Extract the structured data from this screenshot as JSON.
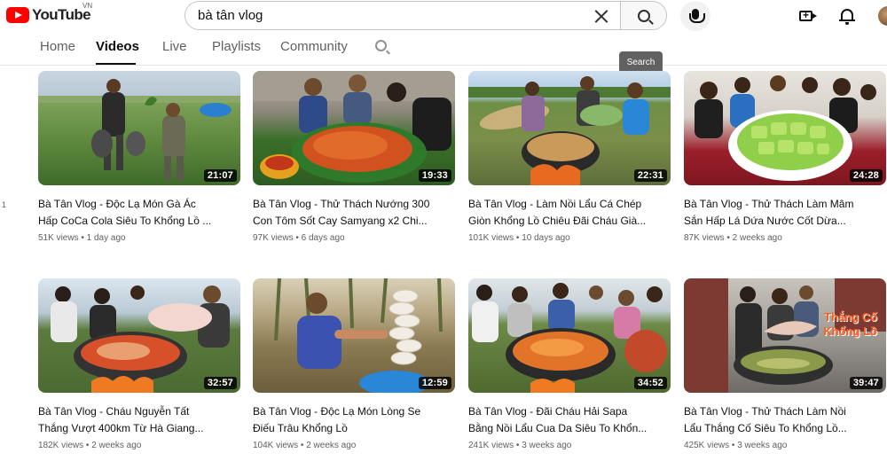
{
  "header": {
    "logo_text": "YouTube",
    "logo_country": "VN",
    "search_value": "bà tân vlog",
    "search_tooltip": "Search",
    "icons": [
      "youtube-logo-icon",
      "clear-icon",
      "search-icon",
      "microphone-icon",
      "create-video-icon",
      "notifications-bell-icon",
      "avatar"
    ]
  },
  "tabs": [
    {
      "label": "Home",
      "active": false
    },
    {
      "label": "Videos",
      "active": true
    },
    {
      "label": "Live",
      "active": false
    },
    {
      "label": "Playlists",
      "active": false
    },
    {
      "label": "Community",
      "active": false
    }
  ],
  "edge_text": "1",
  "videos": [
    {
      "title_line1": "Bà Tân Vlog - Độc Lạ Món Gà Ác",
      "title_line2": "Hấp CoCa Cola Siêu To Khổng Lồ ...",
      "views": "51K views",
      "age": "1 day ago",
      "duration": "21:07",
      "overlay": ""
    },
    {
      "title_line1": "Bà Tân Vlog - Thử Thách Nướng 300",
      "title_line2": "Con Tôm Sốt Cay Samyang x2 Chi...",
      "views": "97K views",
      "age": "6 days ago",
      "duration": "19:33",
      "overlay": ""
    },
    {
      "title_line1": "Bà Tân Vlog - Làm Nồi Lẩu Cá Chép",
      "title_line2": "Giòn Khổng Lồ Chiêu Đãi Cháu Già...",
      "views": "101K views",
      "age": "10 days ago",
      "duration": "22:31",
      "overlay": ""
    },
    {
      "title_line1": "Bà Tân Vlog - Thử Thách Làm Mâm",
      "title_line2": "Sắn Hấp Lá Dứa Nước Cốt Dừa...",
      "views": "87K views",
      "age": "2 weeks ago",
      "duration": "24:28",
      "overlay": ""
    },
    {
      "title_line1": "Bà Tân Vlog - Cháu Nguyễn Tất",
      "title_line2": "Thắng Vượt 400km Từ Hà Giang...",
      "views": "182K views",
      "age": "2 weeks ago",
      "duration": "32:57",
      "overlay": ""
    },
    {
      "title_line1": "Bà Tân Vlog - Độc Lạ Món Lòng Se",
      "title_line2": "Điếu Trâu Khổng Lồ",
      "views": "104K views",
      "age": "2 weeks ago",
      "duration": "12:59",
      "overlay": ""
    },
    {
      "title_line1": "Bà Tân Vlog - Đãi Cháu Hải Sapa",
      "title_line2": "Bằng Nồi Lẩu Cua Da Siêu To Khổn...",
      "views": "241K views",
      "age": "3 weeks ago",
      "duration": "34:52",
      "overlay": ""
    },
    {
      "title_line1": "Bà Tân Vlog - Thử Thách Làm Nồi",
      "title_line2": "Lẩu Thắng Cố Siêu To Khổng Lồ...",
      "views": "425K views",
      "age": "3 weeks ago",
      "duration": "39:47",
      "overlay": "Thắng Cố\nKhổng Lồ"
    }
  ],
  "colors": {
    "brand_red": "#ff0000",
    "text_primary": "#0f0f0f",
    "text_secondary": "#606060",
    "tooltip_bg": "#616161"
  }
}
